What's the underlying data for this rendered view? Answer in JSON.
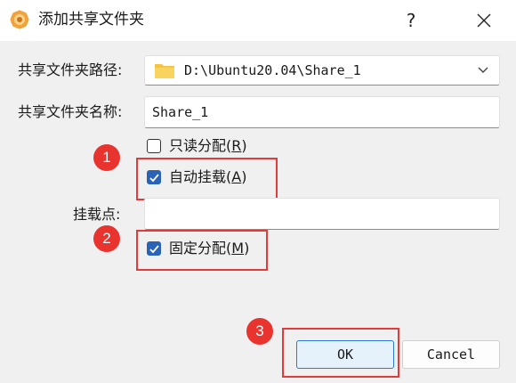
{
  "window": {
    "title": "添加共享文件夹",
    "help_label": "?"
  },
  "form": {
    "path_label": "共享文件夹路径:",
    "path_value": "D:\\Ubuntu20.04\\Share_1",
    "name_label": "共享文件夹名称:",
    "name_value": "Share_1",
    "mount_point_label": "挂载点:",
    "mount_point_value": ""
  },
  "options": {
    "read_only": {
      "label_prefix": "只读分配(",
      "mnemonic": "R",
      "label_suffix": ")",
      "checked": false
    },
    "auto_mount": {
      "label_prefix": "自动挂载(",
      "mnemonic": "A",
      "label_suffix": ")",
      "checked": true
    },
    "permanent": {
      "label_prefix": "固定分配(",
      "mnemonic": "M",
      "label_suffix": ")",
      "checked": true
    }
  },
  "buttons": {
    "ok_label": "OK",
    "cancel_label": "Cancel"
  },
  "annotations": {
    "badge_1": "1",
    "badge_2": "2",
    "badge_3": "3"
  },
  "colors": {
    "annotation_red": "#e23b3b",
    "checkbox_blue": "#2a62b8",
    "folder_yellow": "#f5c542"
  },
  "icons": {
    "app": "virtualbox-gear-icon",
    "folder": "folder-icon",
    "dropdown": "chevron-down-icon",
    "close": "close-icon",
    "check": "checkmark-icon"
  }
}
